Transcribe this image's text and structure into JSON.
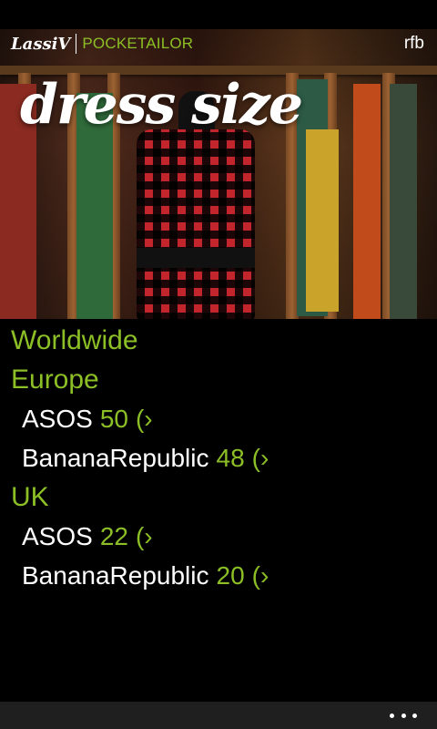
{
  "header": {
    "logo_text": "LassiV",
    "app_name": "POCKETAILOR",
    "user": "rfb",
    "title": "dress size"
  },
  "sections": [
    {
      "title": "Worldwide",
      "items": []
    },
    {
      "title": "Europe",
      "items": [
        {
          "brand": "ASOS",
          "size": "50",
          "chevron": "(›"
        },
        {
          "brand": "BananaRepublic",
          "size": "48",
          "chevron": "(›"
        }
      ]
    },
    {
      "title": "UK",
      "items": [
        {
          "brand": "ASOS",
          "size": "22",
          "chevron": "(›"
        },
        {
          "brand": "BananaRepublic",
          "size": "20",
          "chevron": "(›"
        }
      ]
    }
  ],
  "app_bar": {
    "more_icon": "ellipsis-icon"
  },
  "colors": {
    "accent": "#8cbf26",
    "background": "#000000",
    "app_bar": "#1f1f1f"
  }
}
